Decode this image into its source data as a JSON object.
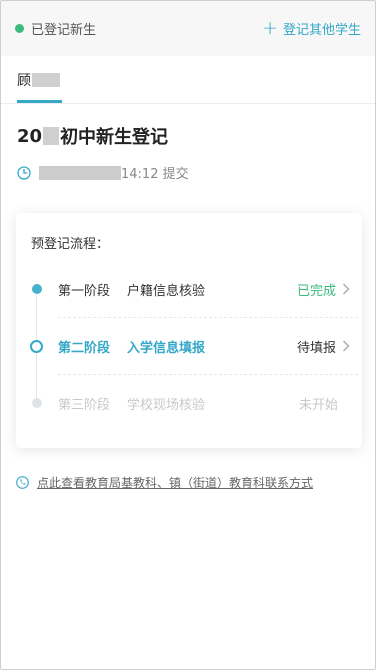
{
  "header": {
    "status_label": "已登记新生",
    "register_other_label": "登记其他学生"
  },
  "tabs": [
    {
      "label_prefix": "顾"
    }
  ],
  "main": {
    "title_prefix": "20",
    "title_suffix": "初中新生登记",
    "submit_time": "14:12 提交"
  },
  "card": {
    "title": "预登记流程：",
    "stages": [
      {
        "name": "第一阶段",
        "desc": "户籍信息核验",
        "state": "已完成"
      },
      {
        "name": "第二阶段",
        "desc": "入学信息填报",
        "state": "待填报"
      },
      {
        "name": "第三阶段",
        "desc": "学校现场核验",
        "state": "未开始"
      }
    ]
  },
  "contact_link": "点此查看教育局基教科、镇（街道）教育科联系方式",
  "colors": {
    "accent": "#35a8c8",
    "success": "#3dbb7d",
    "muted": "#c8c8c8"
  },
  "icons": [
    "status-dot",
    "plus-icon",
    "clock-icon",
    "chevron-right-icon",
    "phone-icon"
  ]
}
